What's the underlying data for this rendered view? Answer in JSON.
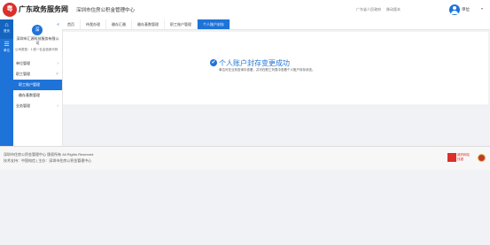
{
  "header": {
    "logo_glyph": "粤",
    "brand": "广东政务服务网",
    "subtitle": "深圳市住房公积金管理中心",
    "links": [
      "广东省人民政府",
      "移动版本"
    ],
    "user_name": "单位",
    "chevron": "▾"
  },
  "rail": {
    "items": [
      {
        "glyph": "⌂",
        "label": "首页"
      },
      {
        "glyph": "☰",
        "label": "单位"
      }
    ]
  },
  "sidebar": {
    "collapse_glyph": "«",
    "org_logo_glyph": "深",
    "org_name": "深圳市汇源科技服务有限公司",
    "org_type": "公司类型：1 统一社会信用代码",
    "menu": [
      {
        "label": "单位管理",
        "child": false,
        "arrow": "›"
      },
      {
        "label": "职工管理",
        "child": false,
        "arrow": "˅"
      },
      {
        "label": "职工账户管理",
        "child": true,
        "active": true
      },
      {
        "label": "缴存基数管理",
        "child": true
      },
      {
        "label": "业务管理",
        "child": false,
        "arrow": "›"
      }
    ]
  },
  "tabs": [
    {
      "label": "首页"
    },
    {
      "label": "待我办理"
    },
    {
      "label": "缴存汇缴"
    },
    {
      "label": "缴存基数管理"
    },
    {
      "label": "职工账户管理"
    },
    {
      "label": "个人账户封存",
      "active": true
    }
  ],
  "result": {
    "icon_glyph": "✔",
    "title": "个人账户封存变更成功",
    "description": "单位可在业务查询中查看，并可在职工列表中查看个人账户封存状态。"
  },
  "footer": {
    "line1": "深圳市住房公积金管理中心 版权所有 All Rights Reserved",
    "line2": "技术支持：中国电信 | 主办：深圳市住房公积金管理中心",
    "gov_label_1": "政府网站",
    "gov_label_2": "找错"
  }
}
